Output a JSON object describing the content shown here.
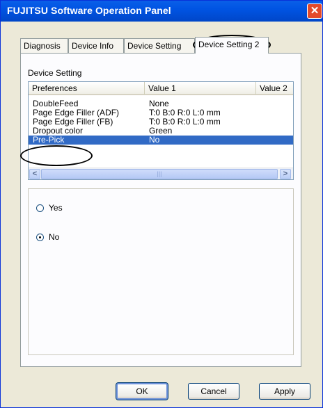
{
  "window": {
    "title": "FUJITSU Software Operation Panel",
    "close_glyph": "✕"
  },
  "tabs": [
    {
      "label": "Diagnosis"
    },
    {
      "label": "Device Info"
    },
    {
      "label": "Device Setting"
    },
    {
      "label": "Device Setting 2"
    }
  ],
  "group": {
    "label": "Device Setting"
  },
  "list": {
    "columns": [
      "Preferences",
      "Value 1",
      "Value 2"
    ],
    "rows": [
      {
        "pref": "DoubleFeed",
        "value": "None"
      },
      {
        "pref": "Page Edge Filler (ADF)",
        "value": "T:0  B:0  R:0  L:0 mm"
      },
      {
        "pref": "Page Edge Filler (FB)",
        "value": "T:0  B:0  R:0  L:0 mm"
      },
      {
        "pref": "Dropout color",
        "value": "Green"
      },
      {
        "pref": "Pre-Pick",
        "value": "No"
      }
    ],
    "scroll_left": "<",
    "scroll_right": ">",
    "scroll_grip": "|||"
  },
  "options": {
    "yes_label": "Yes",
    "no_label": "No",
    "selected": "No"
  },
  "buttons": {
    "ok": "OK",
    "cancel": "Cancel",
    "apply": "Apply"
  },
  "colors": {
    "titlebar": "#0054e3",
    "selection": "#316ac5",
    "close": "#e34a2b"
  },
  "icons": {
    "close": "close-icon",
    "scroll_left": "chevron-left-icon",
    "scroll_right": "chevron-right-icon"
  }
}
